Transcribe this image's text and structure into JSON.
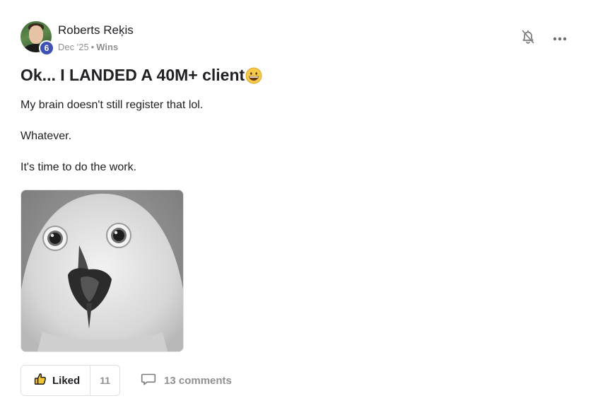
{
  "post": {
    "author": {
      "name": "Roberts Reķis",
      "level": "6"
    },
    "meta": {
      "date": "Dec '25",
      "separator": "•",
      "category": "Wins"
    },
    "title": "Ok... I LANDED A 40M+ client",
    "title_emoji": "grinning-face-emoji",
    "body": [
      "My brain doesn't still register that lol.",
      "Whatever.",
      "It's time to do the work."
    ],
    "image": {
      "subject": "surprised-owl-gif"
    }
  },
  "actions": {
    "like_label": "Liked",
    "like_count": "11",
    "comments_label": "13 comments"
  },
  "icons": {
    "bell": "bell-off-icon",
    "more": "more-horizontal-icon",
    "like": "thumbs-up-icon",
    "comment": "comment-icon"
  },
  "colors": {
    "level_badge": "#3f51b5",
    "text": "#202124",
    "muted": "#909090",
    "border": "#e0e0e0"
  }
}
